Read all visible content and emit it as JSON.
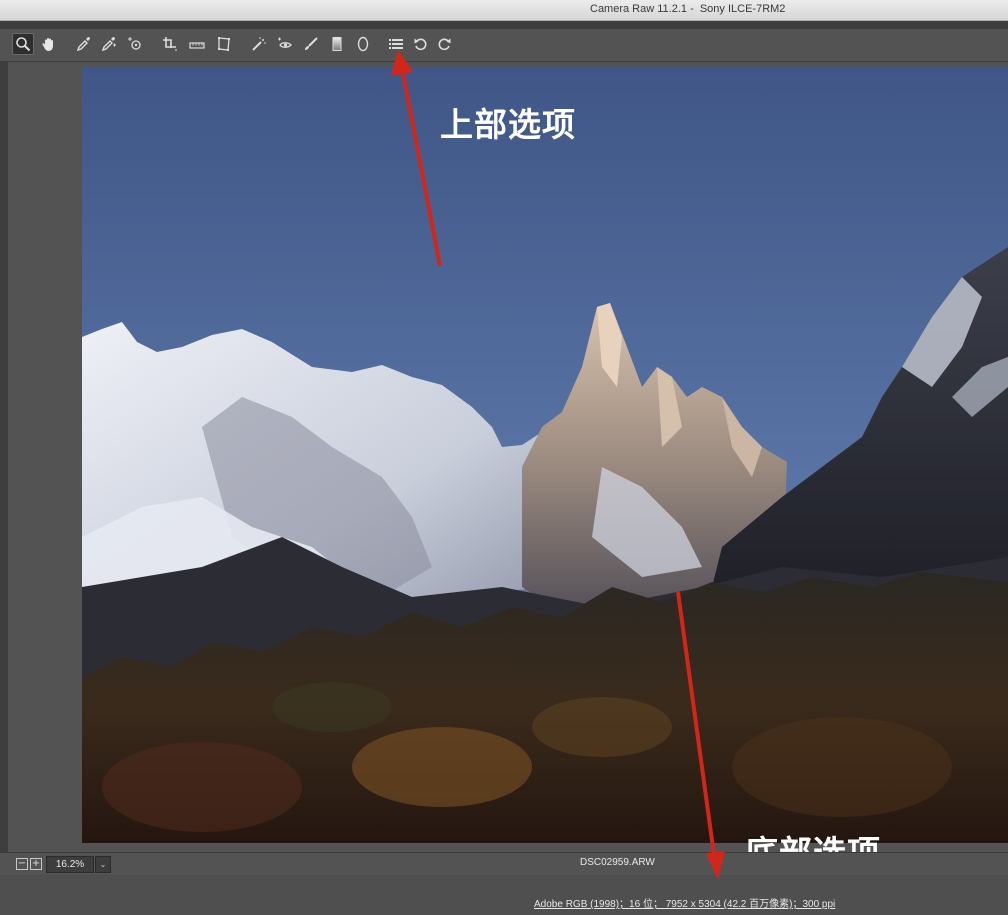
{
  "window": {
    "title": "Camera Raw 11.2.1 -  Sony ILCE-7RM2"
  },
  "toolbar": {
    "tools": [
      {
        "name": "zoom-tool",
        "icon": "magnifier-icon",
        "active": true
      },
      {
        "name": "hand-tool",
        "icon": "hand-icon"
      },
      {
        "name": "white-balance-tool",
        "icon": "eyedropper-icon"
      },
      {
        "name": "color-sampler-tool",
        "icon": "color-sampler-icon"
      },
      {
        "name": "targeted-adjustment-tool",
        "icon": "target-adjust-icon"
      },
      {
        "name": "crop-tool",
        "icon": "crop-icon"
      },
      {
        "name": "straighten-tool",
        "icon": "straighten-icon"
      },
      {
        "name": "transform-tool",
        "icon": "transform-icon"
      },
      {
        "name": "spot-removal-tool",
        "icon": "spot-removal-icon"
      },
      {
        "name": "red-eye-tool",
        "icon": "red-eye-icon"
      },
      {
        "name": "adjustment-brush-tool",
        "icon": "brush-icon"
      },
      {
        "name": "graduated-filter-tool",
        "icon": "graduated-filter-icon"
      },
      {
        "name": "radial-filter-tool",
        "icon": "radial-filter-icon"
      },
      {
        "name": "preferences-button",
        "icon": "list-icon"
      },
      {
        "name": "rotate-left-button",
        "icon": "rotate-ccw-icon"
      },
      {
        "name": "rotate-right-button",
        "icon": "rotate-cw-icon"
      }
    ]
  },
  "annotations": {
    "top": "上部选项",
    "bottom": "底部选项"
  },
  "status": {
    "zoom_out": "−",
    "zoom_in": "+",
    "zoom": "16.2%",
    "zoom_dropdown": "⌄",
    "filename": "DSC02959.ARW"
  },
  "workflow": {
    "options_link": "Adobe RGB (1998)；16 位；  7952 x 5304 (42.2 百万像素)；300 ppi"
  },
  "colors": {
    "arrow": "#d3261b",
    "panel": "#535353",
    "sky": "#4a5f8e"
  }
}
